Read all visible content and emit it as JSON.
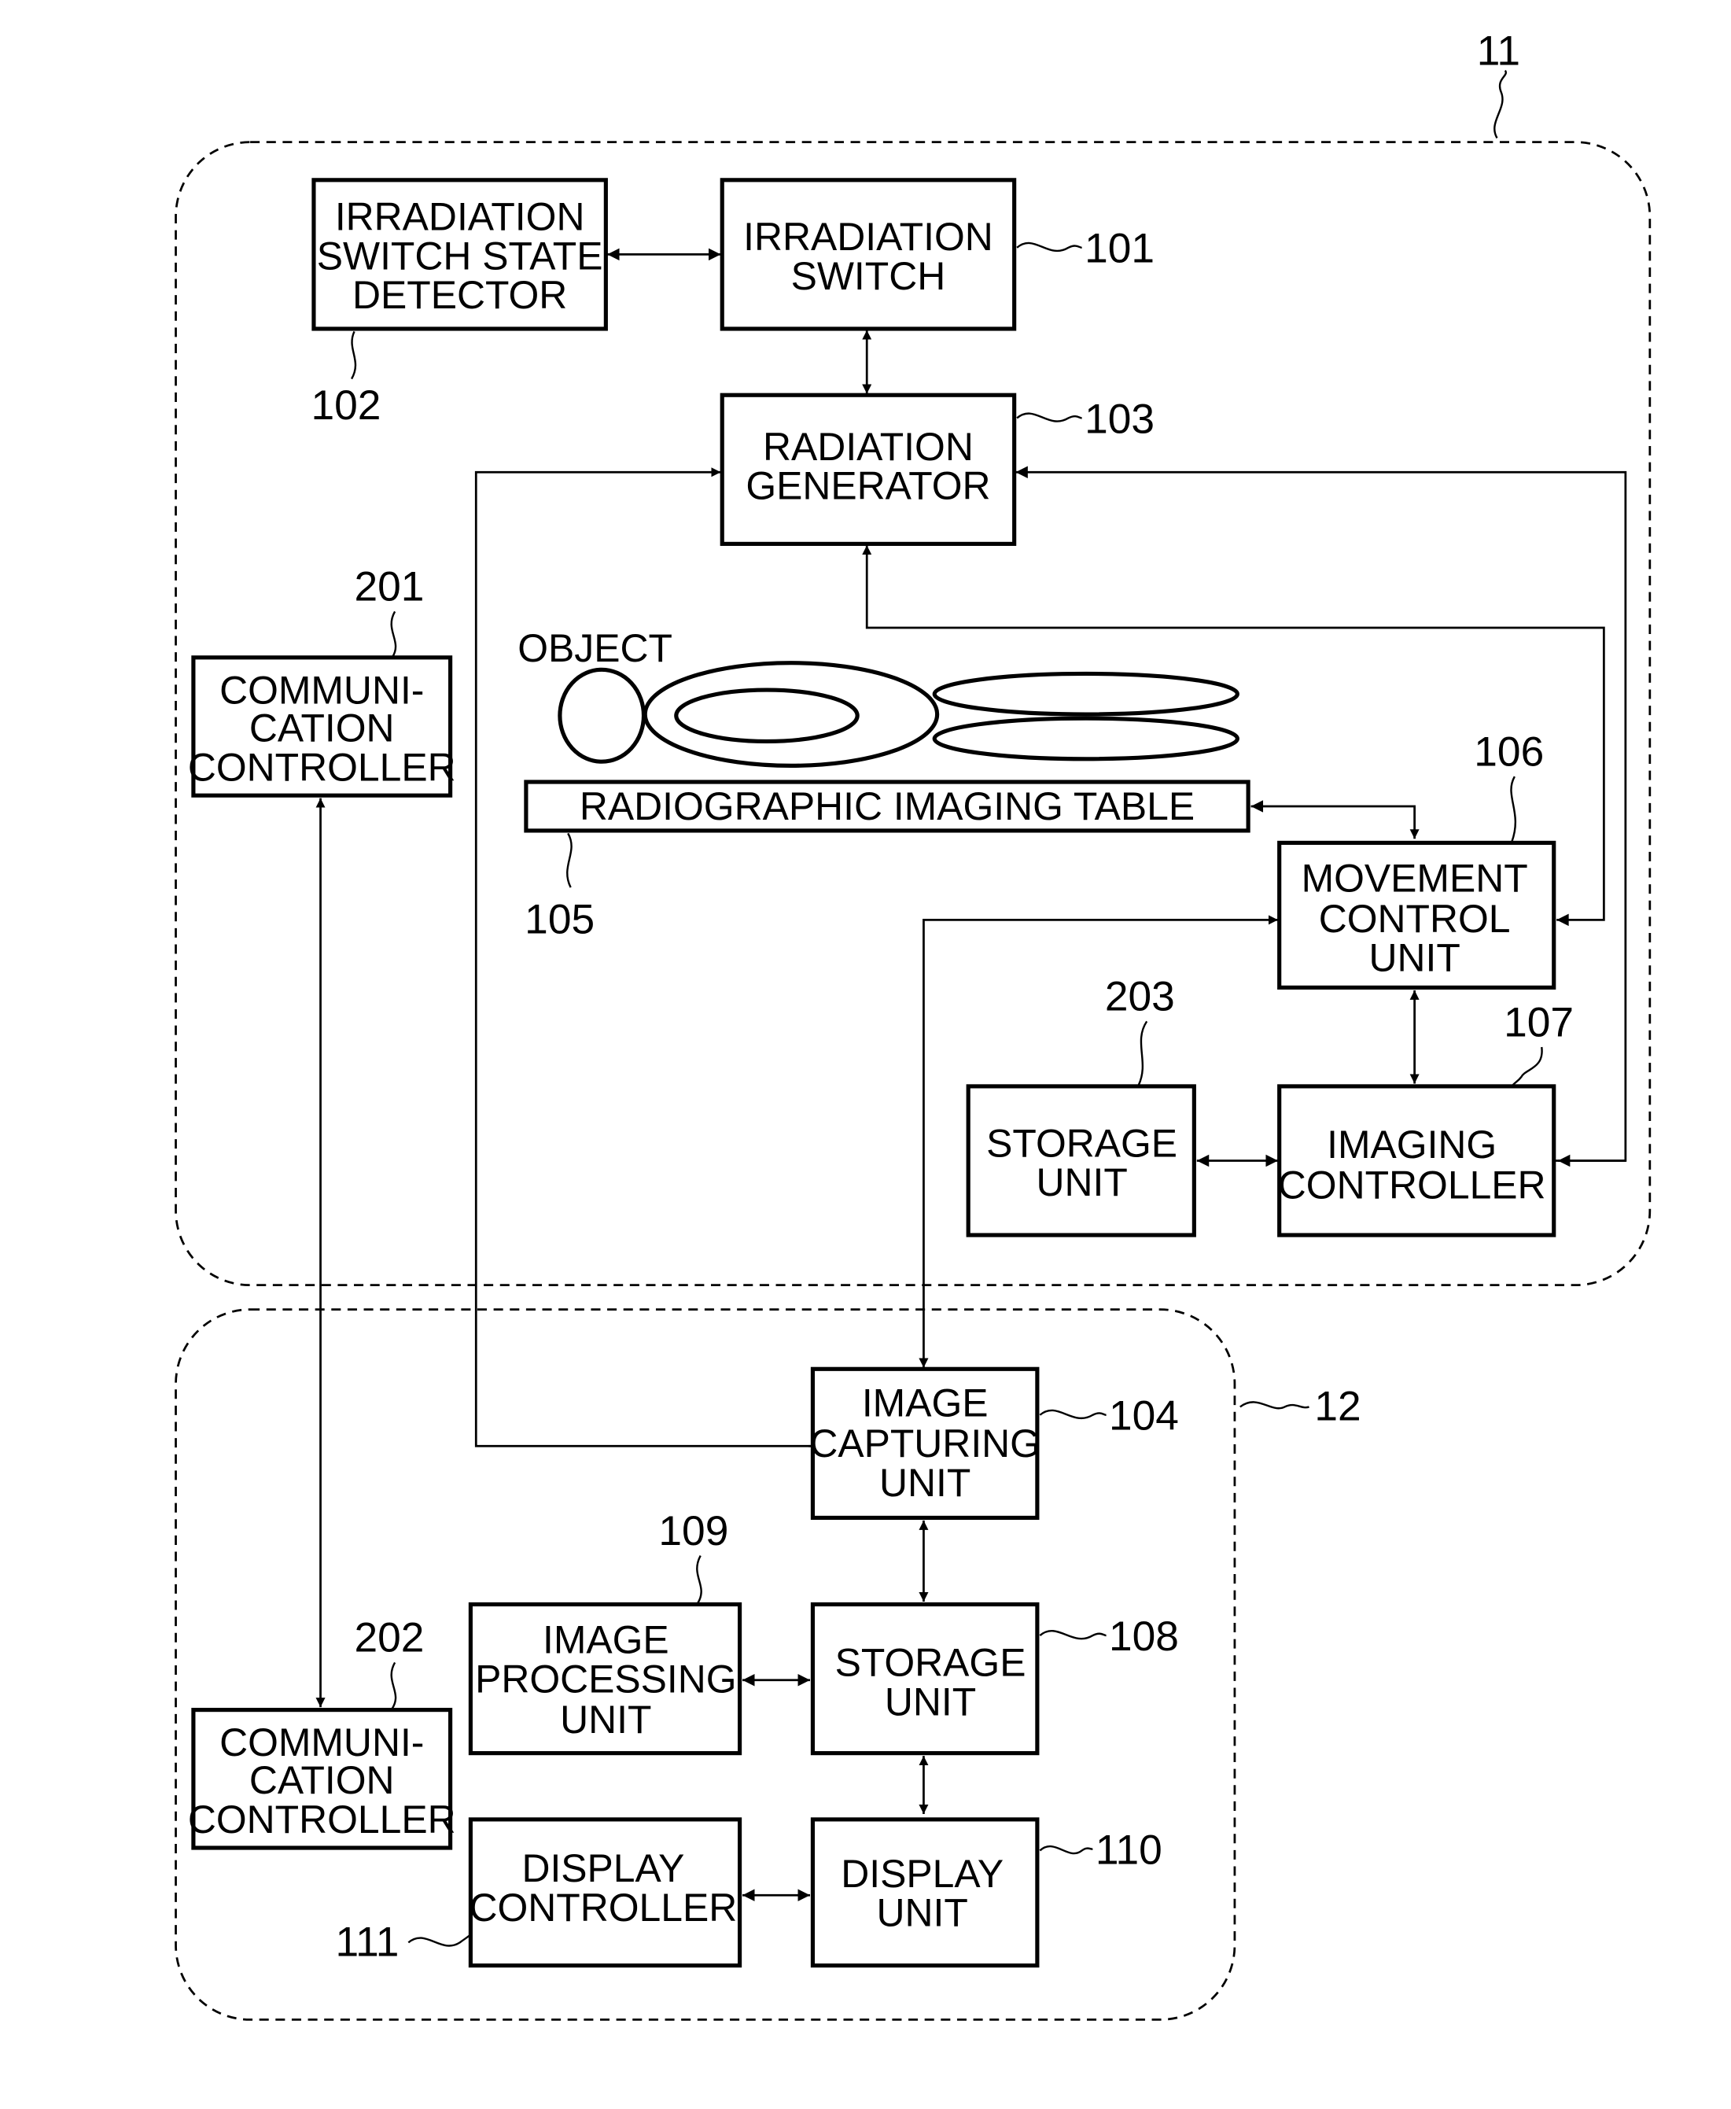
{
  "figure": {
    "groups": [
      {
        "id": "11",
        "ref": "11"
      },
      {
        "id": "12",
        "ref": "12"
      }
    ],
    "blocks": {
      "irradiation_switch_state_detector": {
        "ref": "102",
        "lines": [
          "IRRADIATION",
          "SWITCH STATE",
          "DETECTOR"
        ]
      },
      "irradiation_switch": {
        "ref": "101",
        "lines": [
          "IRRADIATION",
          "SWITCH"
        ]
      },
      "radiation_generator": {
        "ref": "103",
        "lines": [
          "RADIATION",
          "GENERATOR"
        ]
      },
      "communication_controller_201": {
        "ref": "201",
        "lines": [
          "COMMUNI-",
          "CATION",
          "CONTROLLER"
        ]
      },
      "radiographic_imaging_table": {
        "ref": "105",
        "lines": [
          "RADIOGRAPHIC IMAGING TABLE"
        ]
      },
      "movement_control_unit": {
        "ref": "106",
        "lines": [
          "MOVEMENT",
          "CONTROL",
          "UNIT"
        ]
      },
      "storage_unit_203": {
        "ref": "203",
        "lines": [
          "STORAGE",
          "UNIT"
        ]
      },
      "imaging_controller": {
        "ref": "107",
        "lines": [
          "IMAGING",
          "CONTROLLER"
        ]
      },
      "image_capturing_unit": {
        "ref": "104",
        "lines": [
          "IMAGE",
          "CAPTURING",
          "UNIT"
        ]
      },
      "image_processing_unit": {
        "ref": "109",
        "lines": [
          "IMAGE",
          "PROCESSING",
          "UNIT"
        ]
      },
      "storage_unit_108": {
        "ref": "108",
        "lines": [
          "STORAGE",
          "UNIT"
        ]
      },
      "communication_controller_202": {
        "ref": "202",
        "lines": [
          "COMMUNI-",
          "CATION",
          "CONTROLLER"
        ]
      },
      "display_controller": {
        "ref": "111",
        "lines": [
          "DISPLAY",
          "CONTROLLER"
        ]
      },
      "display_unit": {
        "ref": "110",
        "lines": [
          "DISPLAY",
          "UNIT"
        ]
      }
    },
    "object_label": "OBJECT",
    "connections": [
      {
        "from": "irradiation_switch_state_detector",
        "to": "irradiation_switch",
        "type": "bidirectional"
      },
      {
        "from": "irradiation_switch",
        "to": "radiation_generator",
        "type": "bidirectional"
      },
      {
        "from": "image_capturing_unit",
        "to": "radiation_generator",
        "type": "unidirectional"
      },
      {
        "from": "imaging_controller",
        "to": "radiation_generator",
        "type": "unidirectional"
      },
      {
        "from": "radiation_generator",
        "to": "movement_control_unit",
        "type": "unidirectional"
      },
      {
        "from": "radiographic_imaging_table",
        "to": "movement_control_unit",
        "type": "bidirectional"
      },
      {
        "from": "image_capturing_unit",
        "to": "movement_control_unit",
        "type": "bidirectional"
      },
      {
        "from": "movement_control_unit",
        "to": "imaging_controller",
        "type": "bidirectional"
      },
      {
        "from": "storage_unit_203",
        "to": "imaging_controller",
        "type": "bidirectional"
      },
      {
        "from": "communication_controller_201",
        "to": "communication_controller_202",
        "type": "bidirectional"
      },
      {
        "from": "image_capturing_unit",
        "to": "storage_unit_108",
        "type": "bidirectional"
      },
      {
        "from": "image_processing_unit",
        "to": "storage_unit_108",
        "type": "bidirectional"
      },
      {
        "from": "storage_unit_108",
        "to": "display_unit",
        "type": "bidirectional"
      },
      {
        "from": "display_controller",
        "to": "display_unit",
        "type": "bidirectional"
      }
    ]
  }
}
